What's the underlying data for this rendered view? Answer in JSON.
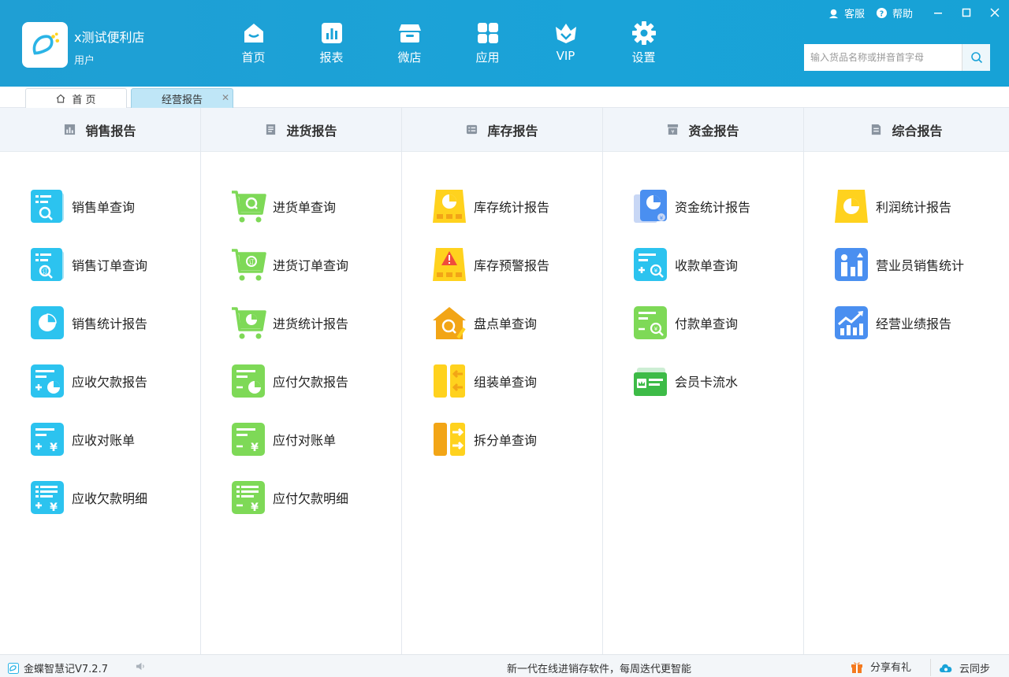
{
  "header": {
    "store_name": "x测试便利店",
    "user_role": "用户",
    "nav": [
      {
        "label": "首页",
        "icon": "home-icon"
      },
      {
        "label": "报表",
        "icon": "report-icon"
      },
      {
        "label": "微店",
        "icon": "shop-icon"
      },
      {
        "label": "应用",
        "icon": "apps-icon"
      },
      {
        "label": "VIP",
        "icon": "vip-icon"
      },
      {
        "label": "设置",
        "icon": "gear-icon"
      }
    ],
    "top_links": {
      "service": "客服",
      "help": "帮助"
    },
    "search": {
      "placeholder": "输入货品名称或拼音首字母",
      "value": ""
    }
  },
  "tabs": {
    "home": "首 页",
    "report": "经营报告"
  },
  "columns": [
    {
      "title": "销售报告",
      "items": [
        "销售单查询",
        "销售订单查询",
        "销售统计报告",
        "应收欠款报告",
        "应收对账单",
        "应收欠款明细"
      ]
    },
    {
      "title": "进货报告",
      "items": [
        "进货单查询",
        "进货订单查询",
        "进货统计报告",
        "应付欠款报告",
        "应付对账单",
        "应付欠款明细"
      ]
    },
    {
      "title": "库存报告",
      "items": [
        "库存统计报告",
        "库存预警报告",
        "盘点单查询",
        "组装单查询",
        "拆分单查询"
      ]
    },
    {
      "title": "资金报告",
      "items": [
        "资金统计报告",
        "收款单查询",
        "付款单查询",
        "会员卡流水"
      ]
    },
    {
      "title": "综合报告",
      "items": [
        "利润统计报告",
        "营业员销售统计",
        "经营业绩报告"
      ]
    }
  ],
  "statusbar": {
    "version": "金蝶智慧记V7.2.7",
    "slogan": "新一代在线进销存软件，每周迭代更智能",
    "share": "分享有礼",
    "sync": "云同步"
  },
  "colors": {
    "header": "#1aa3d8",
    "sales": "#2cc3ef",
    "purchase": "#7ed957",
    "stock": "#ffd21e",
    "fund_blue": "#4a8ff0",
    "fund_green": "#5cd65c"
  }
}
